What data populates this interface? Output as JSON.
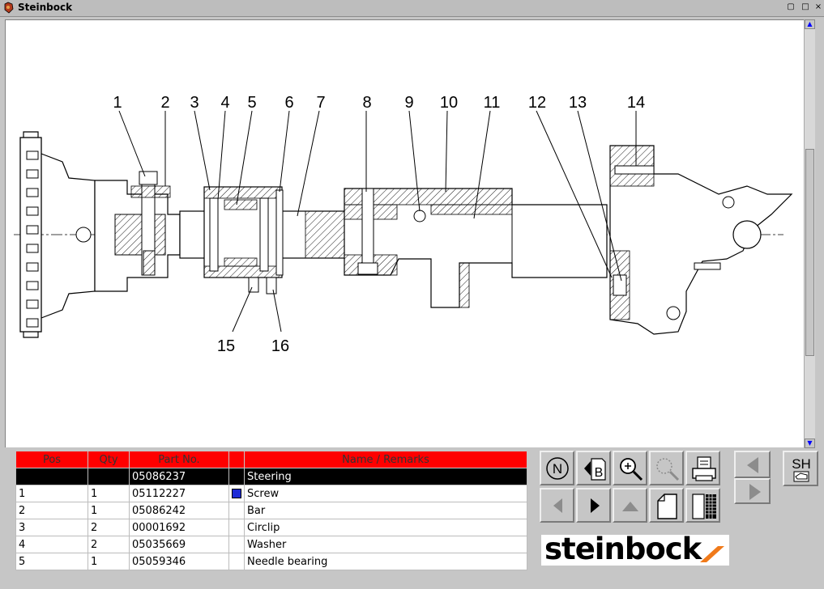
{
  "window": {
    "title": "Steinbock"
  },
  "drawing": {
    "callouts": [
      "1",
      "2",
      "3",
      "4",
      "5",
      "6",
      "7",
      "8",
      "9",
      "10",
      "11",
      "12",
      "13",
      "14",
      "15",
      "16"
    ]
  },
  "table": {
    "headers": [
      "Pos",
      "Qty",
      "Part No.",
      "",
      "Name / Remarks"
    ],
    "rows": [
      {
        "pos": "",
        "qty": "",
        "part_no": "05086237",
        "marker": "",
        "name": "Steering",
        "selected": true
      },
      {
        "pos": "1",
        "qty": "1",
        "part_no": "05112227",
        "marker": "blue-square",
        "name": "Screw"
      },
      {
        "pos": "2",
        "qty": "1",
        "part_no": "05086242",
        "marker": "",
        "name": "Bar"
      },
      {
        "pos": "3",
        "qty": "2",
        "part_no": "00001692",
        "marker": "",
        "name": "Circlip"
      },
      {
        "pos": "4",
        "qty": "2",
        "part_no": "05035669",
        "marker": "",
        "name": "Washer"
      },
      {
        "pos": "5",
        "qty": "1",
        "part_no": "05059346",
        "marker": "",
        "name": "Needle bearing"
      }
    ]
  },
  "toolbar": {
    "n_label": "N",
    "b_label": "B",
    "sh_label": "SH"
  },
  "logo": {
    "text": "steinbock"
  },
  "colors": {
    "header_bg": "#ff0000",
    "selected_row_bg": "#000000",
    "marker": "#1d2bd6"
  }
}
